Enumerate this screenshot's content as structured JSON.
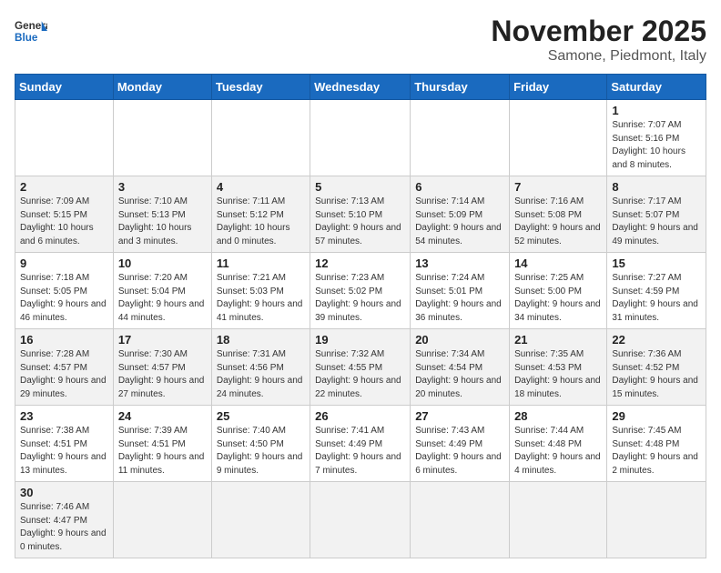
{
  "header": {
    "title": "November 2025",
    "subtitle": "Samone, Piedmont, Italy",
    "logo_general": "General",
    "logo_blue": "Blue"
  },
  "weekdays": [
    "Sunday",
    "Monday",
    "Tuesday",
    "Wednesday",
    "Thursday",
    "Friday",
    "Saturday"
  ],
  "weeks": [
    [
      {
        "day": "",
        "info": ""
      },
      {
        "day": "",
        "info": ""
      },
      {
        "day": "",
        "info": ""
      },
      {
        "day": "",
        "info": ""
      },
      {
        "day": "",
        "info": ""
      },
      {
        "day": "",
        "info": ""
      },
      {
        "day": "1",
        "info": "Sunrise: 7:07 AM\nSunset: 5:16 PM\nDaylight: 10 hours and 8 minutes."
      }
    ],
    [
      {
        "day": "2",
        "info": "Sunrise: 7:09 AM\nSunset: 5:15 PM\nDaylight: 10 hours and 6 minutes."
      },
      {
        "day": "3",
        "info": "Sunrise: 7:10 AM\nSunset: 5:13 PM\nDaylight: 10 hours and 3 minutes."
      },
      {
        "day": "4",
        "info": "Sunrise: 7:11 AM\nSunset: 5:12 PM\nDaylight: 10 hours and 0 minutes."
      },
      {
        "day": "5",
        "info": "Sunrise: 7:13 AM\nSunset: 5:10 PM\nDaylight: 9 hours and 57 minutes."
      },
      {
        "day": "6",
        "info": "Sunrise: 7:14 AM\nSunset: 5:09 PM\nDaylight: 9 hours and 54 minutes."
      },
      {
        "day": "7",
        "info": "Sunrise: 7:16 AM\nSunset: 5:08 PM\nDaylight: 9 hours and 52 minutes."
      },
      {
        "day": "8",
        "info": "Sunrise: 7:17 AM\nSunset: 5:07 PM\nDaylight: 9 hours and 49 minutes."
      }
    ],
    [
      {
        "day": "9",
        "info": "Sunrise: 7:18 AM\nSunset: 5:05 PM\nDaylight: 9 hours and 46 minutes."
      },
      {
        "day": "10",
        "info": "Sunrise: 7:20 AM\nSunset: 5:04 PM\nDaylight: 9 hours and 44 minutes."
      },
      {
        "day": "11",
        "info": "Sunrise: 7:21 AM\nSunset: 5:03 PM\nDaylight: 9 hours and 41 minutes."
      },
      {
        "day": "12",
        "info": "Sunrise: 7:23 AM\nSunset: 5:02 PM\nDaylight: 9 hours and 39 minutes."
      },
      {
        "day": "13",
        "info": "Sunrise: 7:24 AM\nSunset: 5:01 PM\nDaylight: 9 hours and 36 minutes."
      },
      {
        "day": "14",
        "info": "Sunrise: 7:25 AM\nSunset: 5:00 PM\nDaylight: 9 hours and 34 minutes."
      },
      {
        "day": "15",
        "info": "Sunrise: 7:27 AM\nSunset: 4:59 PM\nDaylight: 9 hours and 31 minutes."
      }
    ],
    [
      {
        "day": "16",
        "info": "Sunrise: 7:28 AM\nSunset: 4:57 PM\nDaylight: 9 hours and 29 minutes."
      },
      {
        "day": "17",
        "info": "Sunrise: 7:30 AM\nSunset: 4:57 PM\nDaylight: 9 hours and 27 minutes."
      },
      {
        "day": "18",
        "info": "Sunrise: 7:31 AM\nSunset: 4:56 PM\nDaylight: 9 hours and 24 minutes."
      },
      {
        "day": "19",
        "info": "Sunrise: 7:32 AM\nSunset: 4:55 PM\nDaylight: 9 hours and 22 minutes."
      },
      {
        "day": "20",
        "info": "Sunrise: 7:34 AM\nSunset: 4:54 PM\nDaylight: 9 hours and 20 minutes."
      },
      {
        "day": "21",
        "info": "Sunrise: 7:35 AM\nSunset: 4:53 PM\nDaylight: 9 hours and 18 minutes."
      },
      {
        "day": "22",
        "info": "Sunrise: 7:36 AM\nSunset: 4:52 PM\nDaylight: 9 hours and 15 minutes."
      }
    ],
    [
      {
        "day": "23",
        "info": "Sunrise: 7:38 AM\nSunset: 4:51 PM\nDaylight: 9 hours and 13 minutes."
      },
      {
        "day": "24",
        "info": "Sunrise: 7:39 AM\nSunset: 4:51 PM\nDaylight: 9 hours and 11 minutes."
      },
      {
        "day": "25",
        "info": "Sunrise: 7:40 AM\nSunset: 4:50 PM\nDaylight: 9 hours and 9 minutes."
      },
      {
        "day": "26",
        "info": "Sunrise: 7:41 AM\nSunset: 4:49 PM\nDaylight: 9 hours and 7 minutes."
      },
      {
        "day": "27",
        "info": "Sunrise: 7:43 AM\nSunset: 4:49 PM\nDaylight: 9 hours and 6 minutes."
      },
      {
        "day": "28",
        "info": "Sunrise: 7:44 AM\nSunset: 4:48 PM\nDaylight: 9 hours and 4 minutes."
      },
      {
        "day": "29",
        "info": "Sunrise: 7:45 AM\nSunset: 4:48 PM\nDaylight: 9 hours and 2 minutes."
      }
    ],
    [
      {
        "day": "30",
        "info": "Sunrise: 7:46 AM\nSunset: 4:47 PM\nDaylight: 9 hours and 0 minutes."
      },
      {
        "day": "",
        "info": ""
      },
      {
        "day": "",
        "info": ""
      },
      {
        "day": "",
        "info": ""
      },
      {
        "day": "",
        "info": ""
      },
      {
        "day": "",
        "info": ""
      },
      {
        "day": "",
        "info": ""
      }
    ]
  ]
}
